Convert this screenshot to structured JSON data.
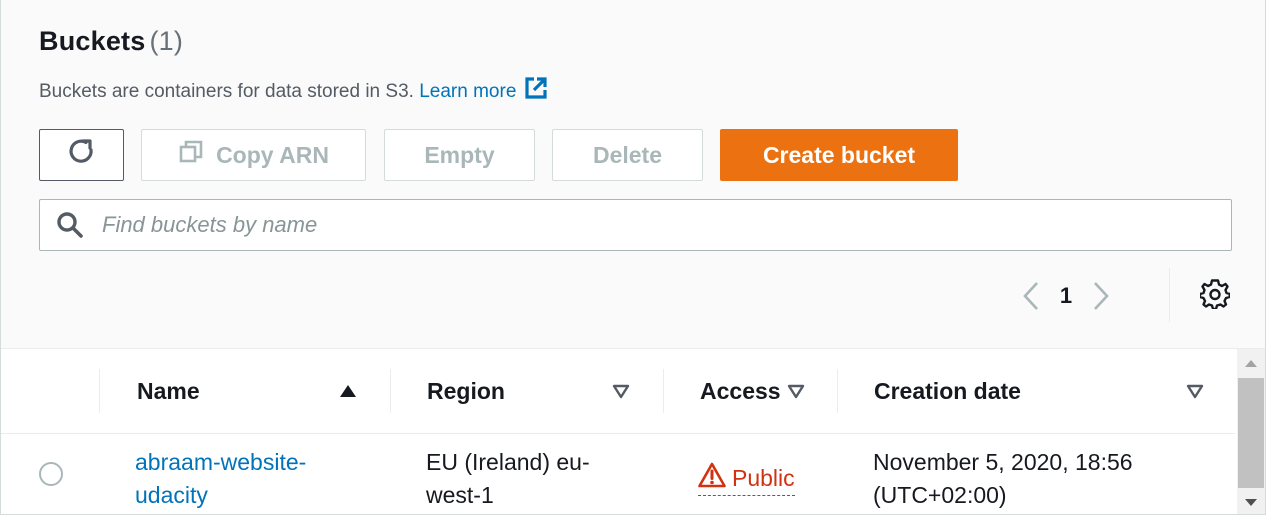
{
  "header": {
    "title": "Buckets",
    "count": "(1)",
    "description": "Buckets are containers for data stored in S3.",
    "learn_more": "Learn more"
  },
  "toolbar": {
    "refresh_icon": "refresh-icon",
    "copy_arn_label": "Copy ARN",
    "copy_icon": "copy-icon",
    "empty_label": "Empty",
    "delete_label": "Delete",
    "create_label": "Create bucket"
  },
  "search": {
    "placeholder": "Find buckets by name",
    "value": ""
  },
  "pagination": {
    "current_page": "1"
  },
  "table": {
    "columns": [
      {
        "label": "Name",
        "sort": "ascending"
      },
      {
        "label": "Region",
        "sort": "none"
      },
      {
        "label": "Access",
        "sort": "none"
      },
      {
        "label": "Creation date",
        "sort": "none"
      }
    ],
    "rows": [
      {
        "name_line1": "abraam-website-",
        "name_line2": "udacity",
        "region_line1": "EU (Ireland) eu-",
        "region_line2": "west-1",
        "access": "Public",
        "created_line1": "November 5, 2020, 18:56",
        "created_line2": "(UTC+02:00)"
      }
    ]
  },
  "colors": {
    "accent": "#ec7211",
    "link": "#0073bb",
    "danger": "#d13212",
    "disabled": "#aab7b8"
  }
}
